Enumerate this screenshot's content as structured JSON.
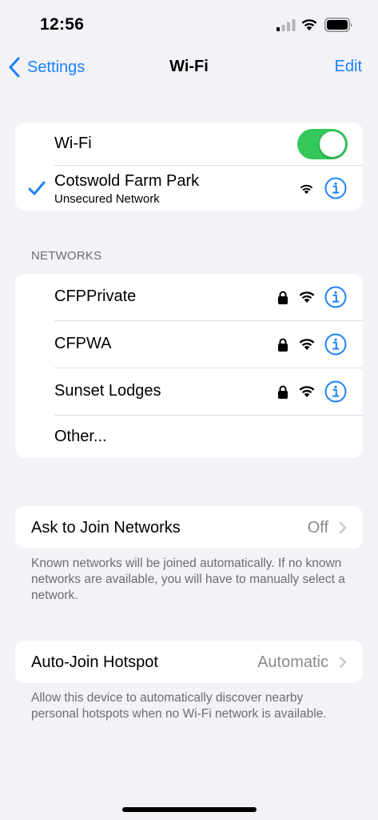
{
  "status": {
    "time": "12:56"
  },
  "nav": {
    "back_label": "Settings",
    "title": "Wi-Fi",
    "edit_label": "Edit"
  },
  "wifi_toggle": {
    "label": "Wi-Fi",
    "on": true
  },
  "connected": {
    "name": "Cotswold Farm Park",
    "subtitle": "Unsecured Network"
  },
  "networks_header": "NETWORKS",
  "networks": [
    {
      "name": "CFPPrivate",
      "secured": true
    },
    {
      "name": "CFPWA",
      "secured": true
    },
    {
      "name": "Sunset Lodges",
      "secured": true
    }
  ],
  "other_label": "Other...",
  "ask_to_join": {
    "label": "Ask to Join Networks",
    "value": "Off",
    "footnote": "Known networks will be joined automatically. If no known networks are available, you will have to manually select a network."
  },
  "auto_join": {
    "label": "Auto-Join Hotspot",
    "value": "Automatic",
    "footnote": "Allow this device to automatically discover nearby personal hotspots when no Wi-Fi network is available."
  },
  "colors": {
    "accent": "#1a82fb",
    "toggle_on": "#34c759",
    "background": "#f2f2f7",
    "secondary_text": "#6d6d72"
  }
}
